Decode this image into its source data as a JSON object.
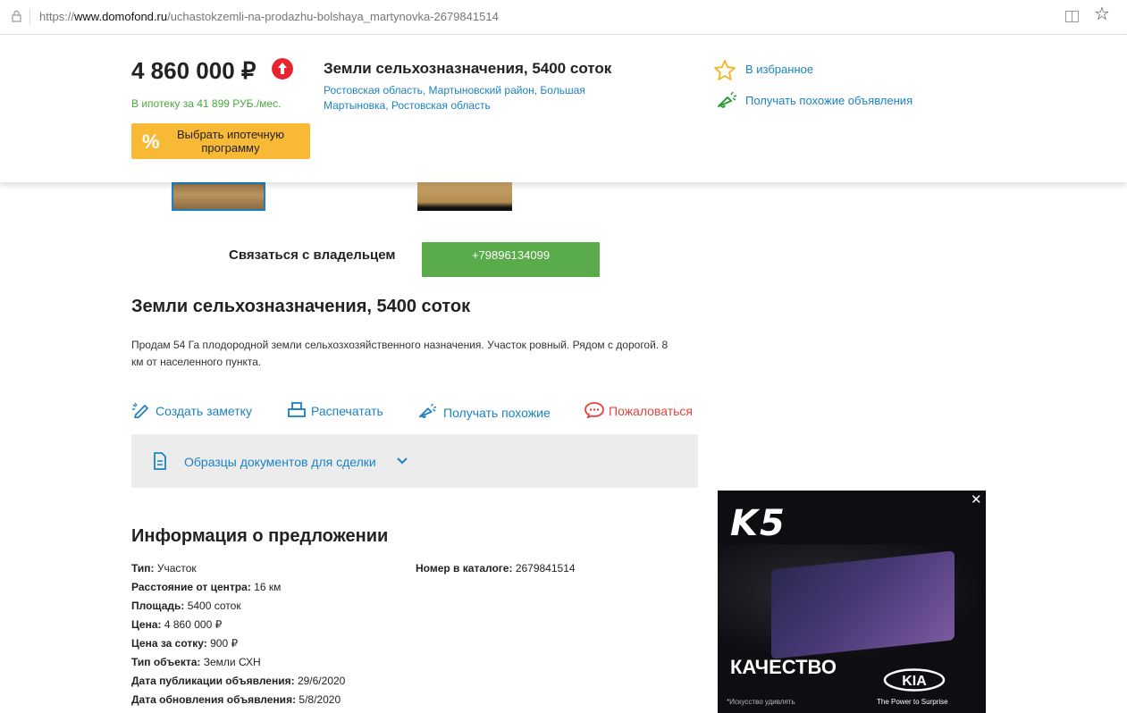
{
  "browser": {
    "url_prefix": "https://",
    "url_host": "www.domofond.ru",
    "url_path": "/uchastokzemli-na-prodazhu-bolshaya_martynovka-2679841514"
  },
  "header": {
    "price": "4 860 000 ₽",
    "mortgage_note": "В ипотеку за 41 899 РУБ./мес.",
    "mortgage_button_icon": "%",
    "mortgage_button_label": "Выбрать ипотечную программу",
    "title": "Земли сельхозназначения, 5400 соток",
    "address": "Ростовская область, Мартыновский район, Большая Мартыновка, Ростовская область",
    "favorite_label": "В избранное",
    "similar_label": "Получать похожие объявления"
  },
  "contact": {
    "label": "Связаться с владельцем",
    "phone": "+79896134099"
  },
  "listing": {
    "title": "Земли сельхозназначения, 5400 соток",
    "description": "Продам 54 Га плодородной земли сельхозхозяйственного назначения. Участок ровный. Рядом с дорогой. 8 км от населенного пункта."
  },
  "actions": {
    "note": "Создать заметку",
    "print": "Распечатать",
    "similar": "Получать похожие",
    "report": "Пожаловаться"
  },
  "docs": {
    "label": "Образцы документов для сделки"
  },
  "info": {
    "title": "Информация о предложении",
    "rows": [
      {
        "key": "Тип:",
        "value": "Участок"
      },
      {
        "key": "Расстояние от центра:",
        "value": "16 км"
      },
      {
        "key": "Площадь:",
        "value": "5400 соток"
      },
      {
        "key": "Цена:",
        "value": "4 860 000 ₽"
      },
      {
        "key": "Цена за сотку:",
        "value": "900 ₽"
      },
      {
        "key": "Тип объекта:",
        "value": "Земли СХН"
      },
      {
        "key": "Дата публикации объявления:",
        "value": "29/6/2020"
      },
      {
        "key": "Дата обновления объявления:",
        "value": "5/8/2020"
      }
    ],
    "catalog_key": "Номер в каталоге:",
    "catalog_value": "2679841514"
  },
  "ad": {
    "close": "✕",
    "model": "K5",
    "headline": "КАЧЕСТВО",
    "fine_print": "*Искусство удивлять",
    "logo": "KIA",
    "tagline": "The Power to Surprise"
  },
  "colors": {
    "link": "#1b82c5",
    "green": "#5aab4a",
    "mortgage": "#f8b937",
    "report": "#e5433b"
  }
}
